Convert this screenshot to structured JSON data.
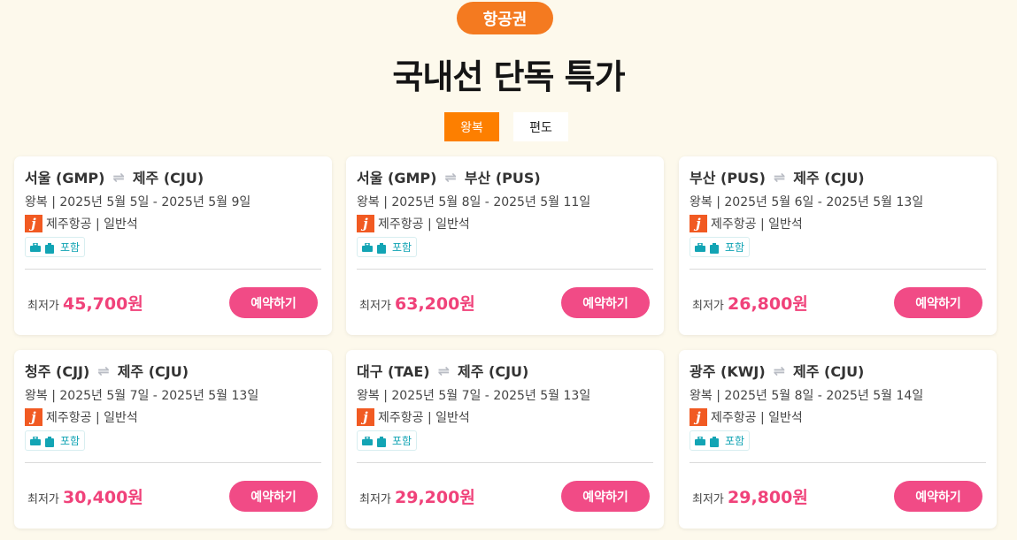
{
  "header": {
    "badge": "항공권",
    "title": "국내선 단독 특가"
  },
  "tabs": [
    {
      "label": "왕복",
      "active": true
    },
    {
      "label": "편도",
      "active": false
    }
  ],
  "colors": {
    "accent_orange": "#f47a20",
    "price_pink": "#f0427a",
    "button_pink": "#f14b86",
    "bag_teal": "#12a4b4"
  },
  "deals": [
    {
      "from": "서울 (GMP)",
      "to": "제주 (CJU)",
      "dates": "왕복 | 2025년 5월 5일 - 2025년 5월 9일",
      "airline": "제주항공 | 일반석",
      "baggage": "포함",
      "price_label": "최저가",
      "price": "45,700원",
      "book_label": "예약하기",
      "logo_letter": "j",
      "swap_icon": "swap-arrows-icon"
    },
    {
      "from": "서울 (GMP)",
      "to": "부산 (PUS)",
      "dates": "왕복 | 2025년 5월 8일 - 2025년 5월 11일",
      "airline": "제주항공 | 일반석",
      "baggage": "포함",
      "price_label": "최저가",
      "price": "63,200원",
      "book_label": "예약하기",
      "logo_letter": "j",
      "swap_icon": "swap-arrows-icon"
    },
    {
      "from": "부산 (PUS)",
      "to": "제주 (CJU)",
      "dates": "왕복 | 2025년 5월 6일 - 2025년 5월 13일",
      "airline": "제주항공 | 일반석",
      "baggage": "포함",
      "price_label": "최저가",
      "price": "26,800원",
      "book_label": "예약하기",
      "logo_letter": "j",
      "swap_icon": "swap-arrows-icon"
    },
    {
      "from": "청주 (CJJ)",
      "to": "제주 (CJU)",
      "dates": "왕복 | 2025년 5월 7일 - 2025년 5월 13일",
      "airline": "제주항공 | 일반석",
      "baggage": "포함",
      "price_label": "최저가",
      "price": "30,400원",
      "book_label": "예약하기",
      "logo_letter": "j",
      "swap_icon": "swap-arrows-icon"
    },
    {
      "from": "대구 (TAE)",
      "to": "제주 (CJU)",
      "dates": "왕복 | 2025년 5월 7일 - 2025년 5월 13일",
      "airline": "제주항공 | 일반석",
      "baggage": "포함",
      "price_label": "최저가",
      "price": "29,200원",
      "book_label": "예약하기",
      "logo_letter": "j",
      "swap_icon": "swap-arrows-icon"
    },
    {
      "from": "광주 (KWJ)",
      "to": "제주 (CJU)",
      "dates": "왕복 | 2025년 5월 8일 - 2025년 5월 14일",
      "airline": "제주항공 | 일반석",
      "baggage": "포함",
      "price_label": "최저가",
      "price": "29,800원",
      "book_label": "예약하기",
      "logo_letter": "j",
      "swap_icon": "swap-arrows-icon"
    }
  ]
}
